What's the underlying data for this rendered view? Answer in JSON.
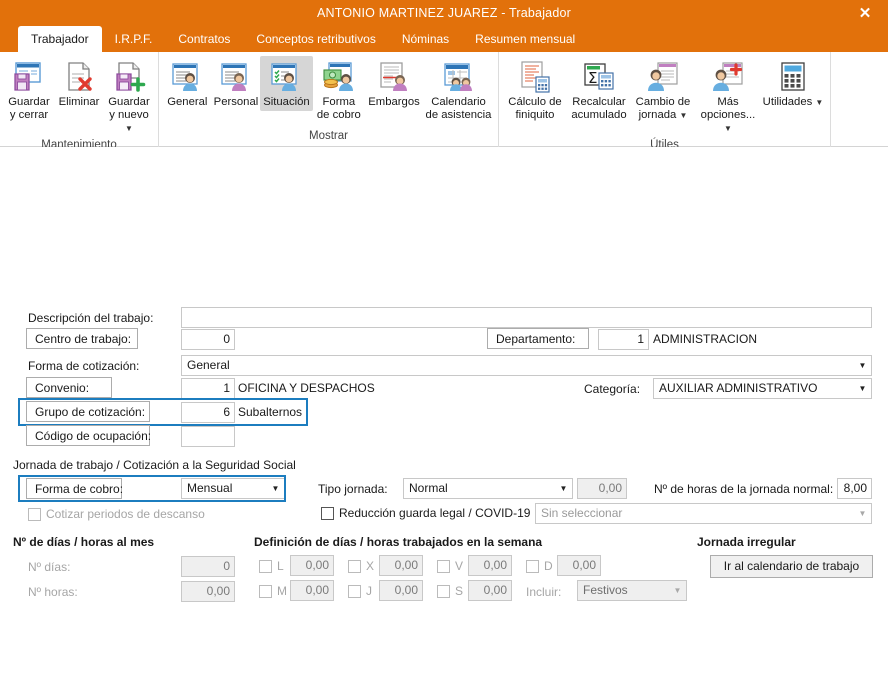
{
  "window": {
    "title": "ANTONIO MARTINEZ JUAREZ - Trabajador",
    "close_label": "✕",
    "accent_color": "#E2710B",
    "highlight_color": "#1C7DBF"
  },
  "tabs": [
    {
      "label": "Trabajador",
      "active": true
    },
    {
      "label": "I.R.P.F.",
      "active": false
    },
    {
      "label": "Contratos",
      "active": false
    },
    {
      "label": "Conceptos retributivos",
      "active": false
    },
    {
      "label": "Nóminas",
      "active": false
    },
    {
      "label": "Resumen mensual",
      "active": false
    }
  ],
  "ribbon": {
    "groups": [
      {
        "label": "Mantenimiento",
        "items": [
          {
            "label": "Guardar\ny cerrar",
            "icon": "save-close-icon",
            "dropdown": false,
            "active": false
          },
          {
            "label": "Eliminar",
            "icon": "delete-icon",
            "dropdown": false,
            "active": false
          },
          {
            "label": "Guardar\ny nuevo",
            "icon": "save-new-icon",
            "dropdown": true,
            "active": false
          }
        ]
      },
      {
        "label": "Mostrar",
        "items": [
          {
            "label": "General",
            "icon": "person-general-icon",
            "dropdown": false,
            "active": false
          },
          {
            "label": "Personal",
            "icon": "person-personal-icon",
            "dropdown": false,
            "active": false
          },
          {
            "label": "Situación",
            "icon": "person-situation-icon",
            "dropdown": false,
            "active": true
          },
          {
            "label": "Forma\nde cobro",
            "icon": "payment-method-icon",
            "dropdown": false,
            "active": false
          },
          {
            "label": "Embargos",
            "icon": "garnishment-icon",
            "dropdown": false,
            "active": false
          },
          {
            "label": "Calendario\nde asistencia",
            "icon": "attendance-calendar-icon",
            "dropdown": false,
            "active": false
          }
        ]
      },
      {
        "label": "Útiles",
        "items": [
          {
            "label": "Cálculo de\nfiniquito",
            "icon": "settlement-calc-icon",
            "dropdown": false,
            "active": false
          },
          {
            "label": "Recalcular\nacumulado",
            "icon": "recalculate-icon",
            "dropdown": false,
            "active": false
          },
          {
            "label": "Cambio de\njornada",
            "icon": "shift-change-icon",
            "dropdown": true,
            "active": false
          },
          {
            "label": "Más\nopciones...",
            "icon": "more-options-icon",
            "dropdown": true,
            "active": false
          },
          {
            "label": "Utilidades",
            "icon": "utilities-icon",
            "dropdown": true,
            "active": false
          }
        ]
      }
    ]
  },
  "form": {
    "descripcion_trabajo": {
      "label": "Descripción del trabajo:",
      "value": ""
    },
    "centro_trabajo": {
      "label": "Centro de trabajo:",
      "value": "0"
    },
    "departamento": {
      "label": "Departamento:",
      "value": "1",
      "text": "ADMINISTRACION"
    },
    "forma_cotizacion": {
      "label": "Forma de cotización:",
      "value": "General"
    },
    "convenio": {
      "label": "Convenio:",
      "value": "1",
      "text": "OFICINA Y DESPACHOS"
    },
    "categoria": {
      "label": "Categoría:",
      "value": "AUXILIAR ADMINISTRATIVO"
    },
    "grupo_cotizacion": {
      "label": "Grupo de cotización:",
      "value": "6",
      "text": "Subalternos",
      "highlighted": true
    },
    "codigo_ocupacion": {
      "label": "Código de ocupación:",
      "value": ""
    }
  },
  "jornada": {
    "section_title": "Jornada de trabajo / Cotización a la Seguridad Social",
    "forma_cobro": {
      "label": "Forma de cobro:",
      "value": "Mensual",
      "highlighted": true
    },
    "cotizar_descanso": {
      "label": "Cotizar periodos de descanso",
      "checked": false,
      "disabled": true
    },
    "tipo_jornada": {
      "label": "Tipo jornada:",
      "value": "Normal",
      "extra_value": "0,00"
    },
    "horas_jornada_normal": {
      "label": "Nº de horas de la jornada normal:",
      "value": "8,00"
    },
    "reduccion": {
      "label": "Reducción guarda legal / COVID-19",
      "checked": false,
      "select_value": "Sin seleccionar"
    }
  },
  "mes": {
    "section_title": "Nº de días / horas al mes",
    "dias": {
      "label": "Nº días:",
      "value": "0"
    },
    "horas": {
      "label": "Nº horas:",
      "value": "0,00"
    }
  },
  "semana": {
    "section_title": "Definición de días / horas trabajados en la semana",
    "days": [
      {
        "code": "L",
        "value": "0,00",
        "checked": false
      },
      {
        "code": "M",
        "value": "0,00",
        "checked": false
      },
      {
        "code": "X",
        "value": "0,00",
        "checked": false
      },
      {
        "code": "J",
        "value": "0,00",
        "checked": false
      },
      {
        "code": "V",
        "value": "0,00",
        "checked": false
      },
      {
        "code": "S",
        "value": "0,00",
        "checked": false
      },
      {
        "code": "D",
        "value": "0,00",
        "checked": false
      }
    ],
    "incluir": {
      "label": "Incluir:",
      "value": "Festivos"
    }
  },
  "irregular": {
    "section_title": "Jornada irregular",
    "button_label": "Ir al calendario de trabajo"
  }
}
